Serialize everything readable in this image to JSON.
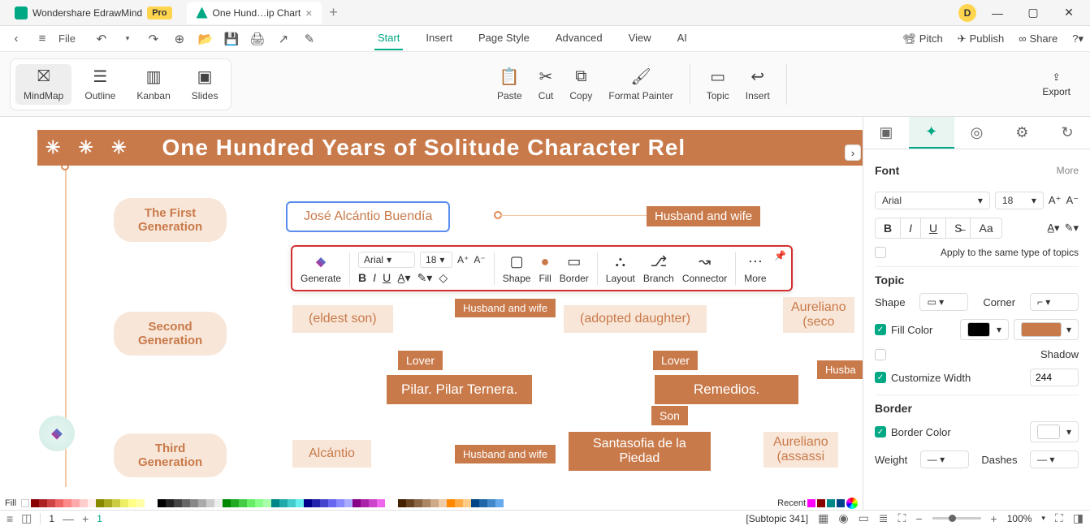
{
  "titlebar": {
    "app_tab": "Wondershare EdrawMind",
    "pro": "Pro",
    "doc_tab": "One Hund…ip Chart",
    "user_initial": "D"
  },
  "menubar": {
    "file": "File",
    "items": [
      "Start",
      "Insert",
      "Page Style",
      "Advanced",
      "View",
      "AI"
    ],
    "right": {
      "pitch": "Pitch",
      "publish": "Publish",
      "share": "Share"
    }
  },
  "ribbon": {
    "views": {
      "mindmap": "MindMap",
      "outline": "Outline",
      "kanban": "Kanban",
      "slides": "Slides"
    },
    "actions": {
      "paste": "Paste",
      "cut": "Cut",
      "copy": "Copy",
      "format_painter": "Format Painter",
      "topic": "Topic",
      "insert": "Insert",
      "export": "Export"
    }
  },
  "canvas": {
    "title_band": "One Hundred Years of Solitude Character Rel",
    "gen1": "The First\nGeneration",
    "gen2": "Second\nGeneration",
    "gen3": "Third\nGeneration",
    "sel_node": "José Alcántio Buendía",
    "husband_wife": "Husband and wife",
    "eldest_son": "(eldest son)",
    "adopted_daughter": "(adopted daughter)",
    "aureliano_second": "Aureliano\n(seco",
    "lover": "Lover",
    "husba": "Husba",
    "pilar": "Pilar. Pilar Ternera.",
    "remedios": "Remedios.",
    "son": "Son",
    "alcantio": "Alcántio",
    "santasofia": "Santasofia de la\nPiedad",
    "aureliano_assassi": "Aureliano\n(assassi"
  },
  "float_tb": {
    "generate": "Generate",
    "font": "Arial",
    "size": "18",
    "shape": "Shape",
    "fill": "Fill",
    "border": "Border",
    "layout": "Layout",
    "branch": "Branch",
    "connector": "Connector",
    "more": "More"
  },
  "rpanel": {
    "font_title": "Font",
    "more": "More",
    "font_family": "Arial",
    "font_size": "18",
    "apply_same": "Apply to the same type of topics",
    "topic_title": "Topic",
    "shape": "Shape",
    "corner": "Corner",
    "fill_color": "Fill Color",
    "shadow": "Shadow",
    "customize_width": "Customize Width",
    "width_val": "244",
    "border_title": "Border",
    "border_color": "Border Color",
    "weight": "Weight",
    "dashes": "Dashes"
  },
  "colorstrip": {
    "fill": "Fill",
    "recent": "Recent"
  },
  "statusbar": {
    "page": "1",
    "page_active": "1",
    "subtopic": "[Subtopic 341]",
    "zoom": "100%"
  }
}
